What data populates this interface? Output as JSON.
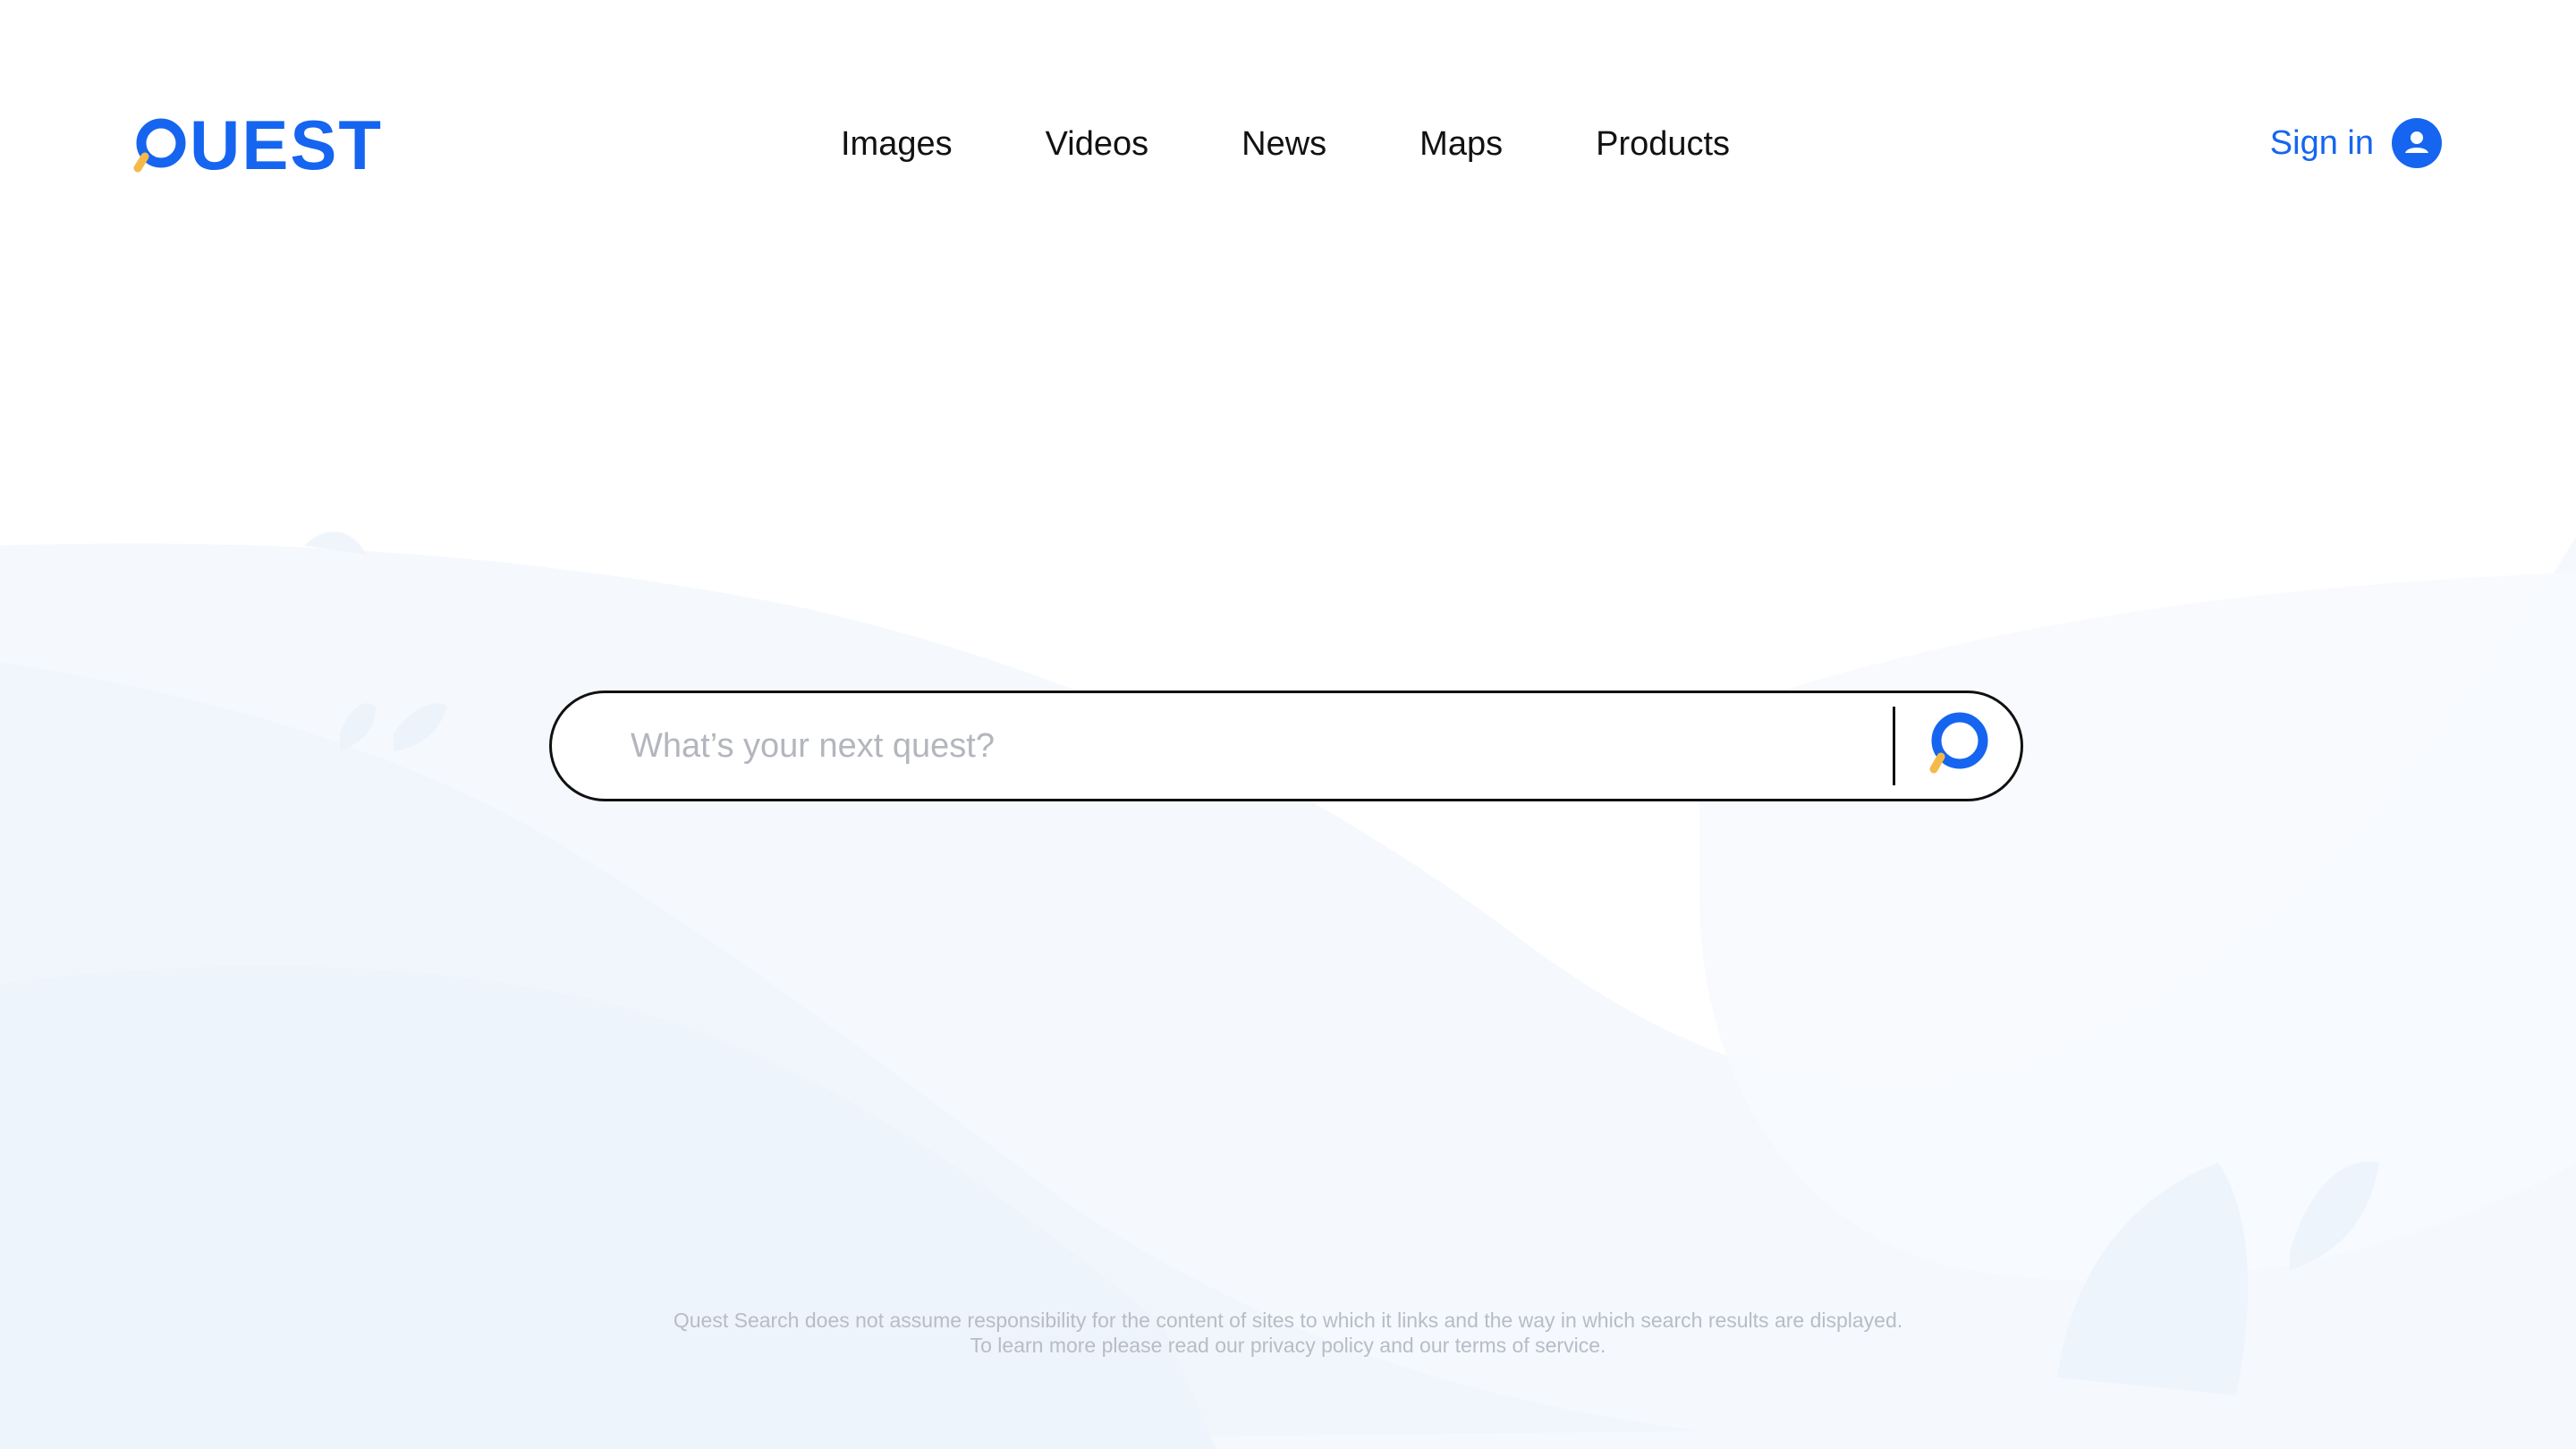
{
  "logo": {
    "text": "UEST",
    "icon": "magnifier-q-icon",
    "full_name": "QUEST"
  },
  "nav": {
    "items": [
      {
        "label": "Images"
      },
      {
        "label": "Videos"
      },
      {
        "label": "News"
      },
      {
        "label": "Maps"
      },
      {
        "label": "Products"
      }
    ]
  },
  "account": {
    "signin_label": "Sign in",
    "icon": "user-icon"
  },
  "search": {
    "placeholder": "What’s your next quest?",
    "value": "",
    "button_icon": "magnifier-q-icon"
  },
  "footer": {
    "line1": "Quest Search does not assume responsibility for the content of sites to which it links and the way in which search results are displayed.",
    "line2": "To learn more please read our privacy policy and our terms of service."
  },
  "colors": {
    "brand": "#1565f0",
    "accent": "#f5b94a",
    "text": "#111111",
    "placeholder": "#b3b6bd",
    "footer_text": "#b7bcc6",
    "wave_light": "#f5f8fd",
    "wave_mid": "#eef4fc"
  }
}
